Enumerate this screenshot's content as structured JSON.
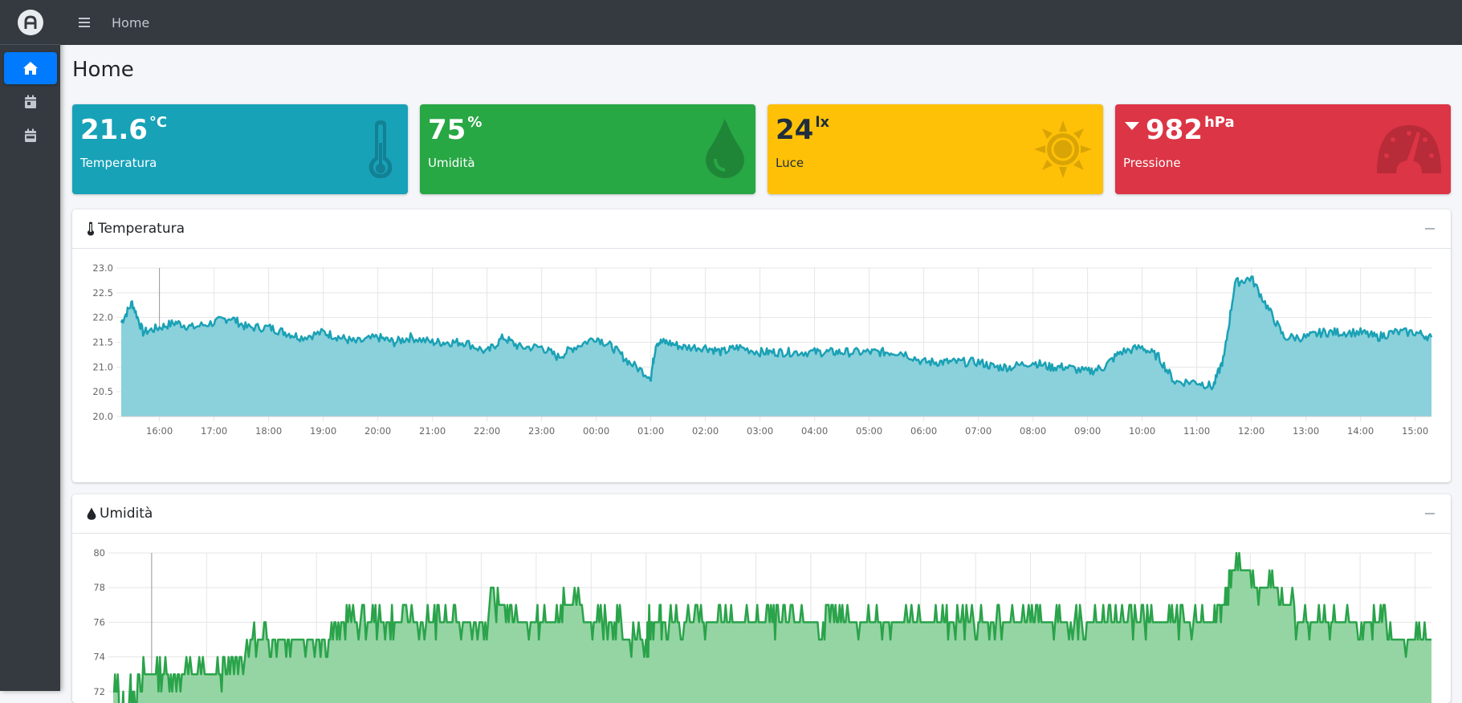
{
  "sidebar": {
    "logo_icon": "logo-icon",
    "items": [
      {
        "icon": "home-icon",
        "active": true
      },
      {
        "icon": "calendar-day-icon",
        "active": false
      },
      {
        "icon": "calendar-week-icon",
        "active": false
      }
    ]
  },
  "topbar": {
    "menu_icon": "bars-icon",
    "breadcrumb": "Home"
  },
  "page": {
    "title": "Home"
  },
  "stats": [
    {
      "value": "21.6",
      "unit": "°C",
      "label": "Temperatura",
      "icon": "thermometer-icon",
      "color": "#17a2b8"
    },
    {
      "value": "75",
      "unit": "%",
      "label": "Umidità",
      "icon": "drop-icon",
      "color": "#28a745"
    },
    {
      "value": "24",
      "unit": "lx",
      "label": "Luce",
      "icon": "sun-icon",
      "color": "#ffc107"
    },
    {
      "value": "982",
      "unit": "hPa",
      "label": "Pressione",
      "icon": "gauge-icon",
      "color": "#dc3545",
      "trend_icon": "caret-down-icon"
    }
  ],
  "cards": {
    "temperature": {
      "title": "Temperatura",
      "icon": "thermometer-icon"
    },
    "humidity": {
      "title": "Umidità",
      "icon": "drop-icon"
    }
  },
  "chart_data": [
    {
      "type": "area",
      "title": "Temperatura",
      "x_ticks": [
        "16:00",
        "17:00",
        "18:00",
        "19:00",
        "20:00",
        "21:00",
        "22:00",
        "23:00",
        "00:00",
        "01:00",
        "02:00",
        "03:00",
        "04:00",
        "05:00",
        "06:00",
        "07:00",
        "08:00",
        "09:00",
        "10:00",
        "11:00",
        "12:00",
        "13:00",
        "14:00",
        "15:00"
      ],
      "y_ticks": [
        "23.0",
        "22.5",
        "22.0",
        "21.5",
        "21.0",
        "20.5",
        "20.0"
      ],
      "ylim": [
        20.0,
        23.0
      ],
      "x": [
        15.3,
        15.5,
        15.7,
        16.0,
        16.3,
        16.6,
        17.0,
        17.3,
        17.6,
        18.0,
        18.3,
        18.6,
        19.0,
        19.3,
        19.6,
        20.0,
        20.3,
        20.6,
        21.0,
        21.3,
        21.6,
        22.0,
        22.3,
        22.6,
        23.0,
        23.3,
        23.6,
        24.0,
        24.3,
        24.6,
        25.0,
        25.1,
        25.3,
        25.6,
        26.0,
        26.3,
        26.6,
        27.0,
        27.3,
        27.6,
        28.0,
        28.3,
        28.6,
        29.0,
        29.3,
        29.6,
        30.0,
        30.3,
        30.6,
        31.0,
        31.3,
        31.6,
        32.0,
        32.3,
        32.6,
        33.0,
        33.3,
        33.6,
        34.0,
        34.3,
        34.6,
        35.0,
        35.3,
        35.5,
        35.7,
        36.0,
        36.3,
        36.6,
        37.0,
        37.3,
        37.6,
        38.0,
        38.3,
        38.6,
        39.0,
        39.3
      ],
      "values": [
        21.9,
        22.3,
        21.7,
        21.8,
        21.9,
        21.8,
        21.9,
        22.0,
        21.8,
        21.8,
        21.7,
        21.6,
        21.7,
        21.6,
        21.5,
        21.6,
        21.5,
        21.6,
        21.5,
        21.5,
        21.5,
        21.3,
        21.6,
        21.4,
        21.4,
        21.2,
        21.4,
        21.6,
        21.4,
        21.1,
        20.8,
        21.5,
        21.5,
        21.4,
        21.4,
        21.3,
        21.4,
        21.3,
        21.3,
        21.3,
        21.3,
        21.3,
        21.3,
        21.3,
        21.3,
        21.3,
        21.1,
        21.1,
        21.1,
        21.1,
        21.0,
        21.0,
        21.1,
        21.0,
        21.0,
        20.9,
        21.0,
        21.3,
        21.4,
        21.2,
        20.7,
        20.7,
        20.6,
        21.2,
        22.7,
        22.8,
        22.2,
        21.6,
        21.6,
        21.7,
        21.7,
        21.7,
        21.6,
        21.7,
        21.7,
        21.6
      ]
    },
    {
      "type": "area",
      "title": "Umidità",
      "y_ticks": [
        "80",
        "78",
        "76",
        "74",
        "72"
      ],
      "ylim": [
        70,
        80
      ],
      "x": [
        15.3,
        15.5,
        15.7,
        16.0,
        16.3,
        16.6,
        17.0,
        17.3,
        17.6,
        18.0,
        18.3,
        18.6,
        19.0,
        19.3,
        19.6,
        20.0,
        20.3,
        20.6,
        21.0,
        21.3,
        21.6,
        22.0,
        22.3,
        22.6,
        23.0,
        23.3,
        23.6,
        24.0,
        24.3,
        24.6,
        25.0,
        25.1,
        25.3,
        25.6,
        26.0,
        26.3,
        26.6,
        27.0,
        27.3,
        27.6,
        28.0,
        28.3,
        28.6,
        29.0,
        29.3,
        29.6,
        30.0,
        30.3,
        30.6,
        31.0,
        31.3,
        31.6,
        32.0,
        32.3,
        32.6,
        33.0,
        33.3,
        33.6,
        34.0,
        34.3,
        34.6,
        35.0,
        35.3,
        35.5,
        35.7,
        36.0,
        36.3,
        36.6,
        37.0,
        37.3,
        37.6,
        38.0,
        38.3,
        38.6,
        39.0,
        39.3
      ],
      "values": [
        72,
        71,
        72,
        73,
        73,
        73,
        73,
        73,
        74,
        75,
        75,
        75,
        75,
        75,
        76,
        76,
        76,
        76,
        76,
        76,
        76,
        76,
        77,
        76,
        76,
        76,
        77,
        76,
        76,
        75.5,
        75,
        76,
        76,
        76,
        76,
        76,
        76,
        76,
        76,
        76,
        76,
        76,
        76,
        76,
        76,
        76,
        76,
        76,
        76,
        76,
        76,
        76,
        76,
        76,
        76,
        76,
        76,
        76,
        76,
        76,
        76,
        76,
        76,
        77,
        79,
        78.5,
        78,
        77,
        76,
        76,
        76,
        76,
        76,
        75,
        75,
        75
      ]
    }
  ]
}
